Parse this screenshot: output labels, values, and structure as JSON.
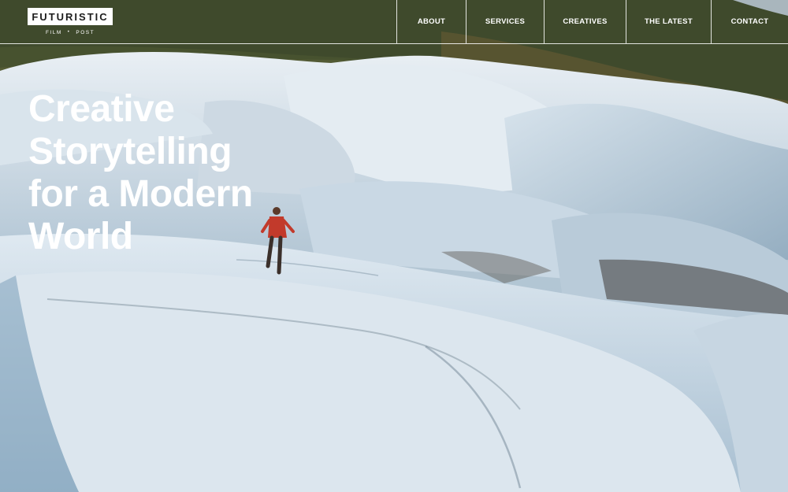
{
  "brand": {
    "name": "FUTURISTIC",
    "sub_left": "FILM",
    "sub_sep": "•",
    "sub_right": "POST"
  },
  "nav": {
    "items": [
      {
        "label": "ABOUT"
      },
      {
        "label": "SERVICES"
      },
      {
        "label": "CREATIVES"
      },
      {
        "label": "THE LATEST"
      },
      {
        "label": "CONTACT"
      }
    ]
  },
  "hero": {
    "lines": [
      "Creative",
      "Storytelling",
      "for a Modern",
      "World"
    ]
  },
  "colors": {
    "text": "#ffffff",
    "logo_bg": "#ffffff",
    "logo_text": "#1d1d1d",
    "hiker_jacket": "#c23a2b"
  }
}
